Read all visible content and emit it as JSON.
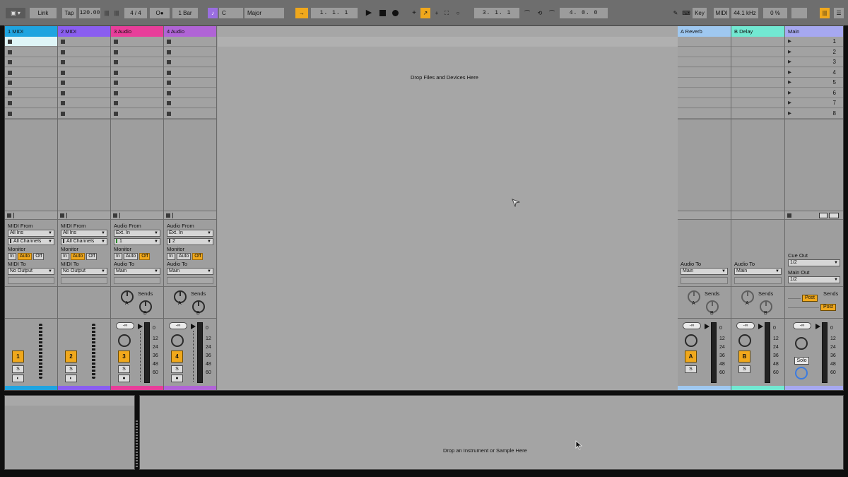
{
  "topbar": {
    "link": "Link",
    "tap": "Tap",
    "tempo": "120.00",
    "time_sig": "4 / 4",
    "metronome": "O●",
    "quantize": "1 Bar",
    "key": "C",
    "scale": "Major",
    "arrangement_position": "1.   1.   1",
    "loop_start": "3.   1.   1",
    "loop_length": "4.   0.   0",
    "key_map": "Key",
    "midi_map": "MIDI",
    "sample_rate": "44.1 kHz",
    "cpu": "0 %"
  },
  "tracks": [
    {
      "name": "1 MIDI",
      "color": "#1fa4e0",
      "number": "1",
      "type": "midi",
      "from_label": "MIDI From",
      "from_value": "All Ins",
      "channel": "All Channels",
      "to_label": "MIDI To",
      "to_value": "No Output",
      "monitor": "Auto"
    },
    {
      "name": "2 MIDI",
      "color": "#8a5ef0",
      "number": "2",
      "type": "midi",
      "from_label": "MIDI From",
      "from_value": "All Ins",
      "channel": "All Channels",
      "to_label": "MIDI To",
      "to_value": "No Output",
      "monitor": "Auto"
    },
    {
      "name": "3 Audio",
      "color": "#e83e9a",
      "number": "3",
      "type": "audio",
      "from_label": "Audio From",
      "from_value": "Ext. In",
      "channel": "1",
      "to_label": "Audio To",
      "to_value": "Main",
      "monitor": "Off"
    },
    {
      "name": "4 Audio",
      "color": "#b064d6",
      "number": "4",
      "type": "audio",
      "from_label": "Audio From",
      "from_value": "Ext. In",
      "channel": "2",
      "to_label": "Audio To",
      "to_value": "Main",
      "monitor": "Off"
    }
  ],
  "returns": [
    {
      "name": "A Reverb",
      "color": "#9fc8f0",
      "letter": "A",
      "to_label": "Audio To",
      "to_value": "Main"
    },
    {
      "name": "B Delay",
      "color": "#72e8d2",
      "letter": "B",
      "to_label": "Audio To",
      "to_value": "Main"
    }
  ],
  "main": {
    "name": "Main",
    "color": "#a6a8f0",
    "scenes": [
      "1",
      "2",
      "3",
      "4",
      "5",
      "6",
      "7",
      "8"
    ],
    "cue_label": "Cue Out",
    "cue_value": "1/2",
    "out_label": "Main Out",
    "out_value": "1/2",
    "solo": "Solo",
    "post1": "Post",
    "post2": "Post"
  },
  "io": {
    "monitor": "Monitor",
    "in": "In",
    "auto": "Auto",
    "off": "Off",
    "sends": "Sends",
    "knob_a": "A",
    "knob_b": "B",
    "vol": "-∞",
    "solo": "S",
    "scale": [
      "0",
      "12",
      "24",
      "36",
      "48",
      "60"
    ]
  },
  "drop_files": "Drop Files and Devices Here",
  "drop_instrument": "Drop an Instrument or Sample Here",
  "colors": {
    "accent": "#f0a81c",
    "background": "#9e9e9e",
    "topbar": "#6e6e6e"
  }
}
